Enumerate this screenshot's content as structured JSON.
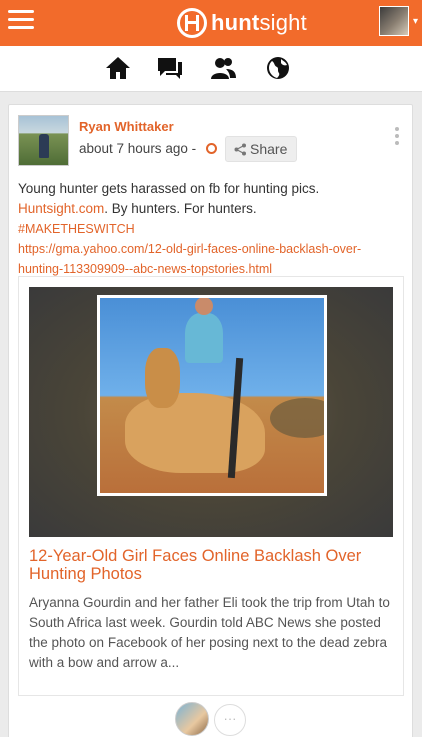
{
  "app": {
    "brand_bold": "hunt",
    "brand_light": "sight",
    "accent_color": "#f26b2b"
  },
  "nav": {
    "icons": [
      "home-icon",
      "chat-icon",
      "users-icon",
      "globe-icon"
    ]
  },
  "post": {
    "author": "Ryan Whittaker",
    "time": "about 7 hours ago -",
    "share_label": "Share",
    "text_line1": "Young hunter gets harassed on fb for hunting pics.",
    "site_link": "Huntsight.com",
    "tagline": ". By hunters. For hunters.",
    "hashtag": "#MAKETHESWITCH",
    "url": "https://gma.yahoo.com/12-old-girl-faces-online-backlash-over-hunting-113309909--abc-news-topstories.html"
  },
  "preview": {
    "title": "12-Year-Old Girl Faces Online Backlash Over Hunting Photos",
    "description": "Aryanna Gourdin and her father Eli took the trip from Utah to South Africa last week. Gourdin told ABC News she posted the photo on Facebook of her posing next to the dead zebra with a bow and arrow a..."
  },
  "reactions": {
    "more_label": "···"
  }
}
